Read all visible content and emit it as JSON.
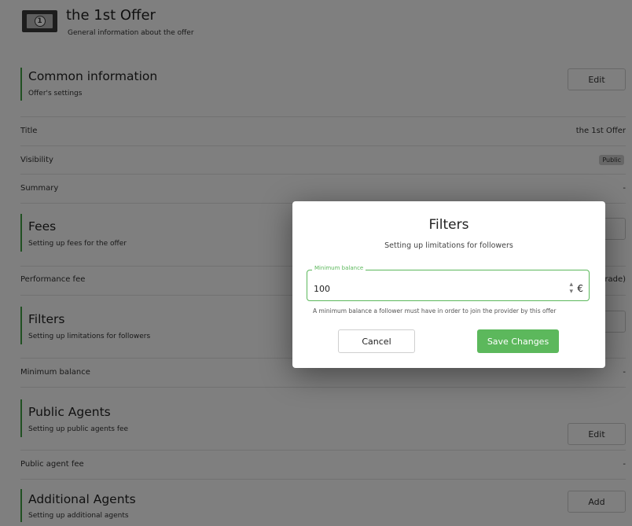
{
  "offer": {
    "icon": "banknote-icon",
    "icon_number": "1",
    "title": "the 1st Offer",
    "subtitle": "General information about the offer"
  },
  "common": {
    "title": "Common information",
    "subtitle": "Offer's settings",
    "button": "Edit",
    "rows": {
      "title_label": "Title",
      "title_value": "the 1st Offer",
      "visibility_label": "Visibility",
      "visibility_value": "Public",
      "summary_label": "Summary",
      "summary_value": "-"
    }
  },
  "fees": {
    "title": "Fees",
    "subtitle": "Setting up fees for the offer",
    "performance_label": "Performance fee",
    "performance_value_partial": "rade)"
  },
  "filters": {
    "title": "Filters",
    "subtitle": "Setting up limitations for followers",
    "minimum_label": "Minimum balance",
    "minimum_value": "-"
  },
  "public_agents": {
    "title": "Public Agents",
    "subtitle": "Setting up public agents fee",
    "button": "Edit",
    "fee_label": "Public agent fee",
    "fee_value": "-"
  },
  "additional_agents": {
    "title": "Additional Agents",
    "subtitle": "Setting up additional agents",
    "button": "Add"
  },
  "modal": {
    "title": "Filters",
    "subtitle": "Setting up limitations for followers",
    "field_label": "Minimum balance",
    "field_value": "100",
    "currency": "€",
    "hint": "A minimum balance a follower must have in order to join the provider by this offer",
    "cancel": "Cancel",
    "save": "Save Changes"
  },
  "colors": {
    "accent": "#5cb85c",
    "section_bar": "#43a047",
    "overlay": "rgba(0,0,0,0.5)"
  }
}
